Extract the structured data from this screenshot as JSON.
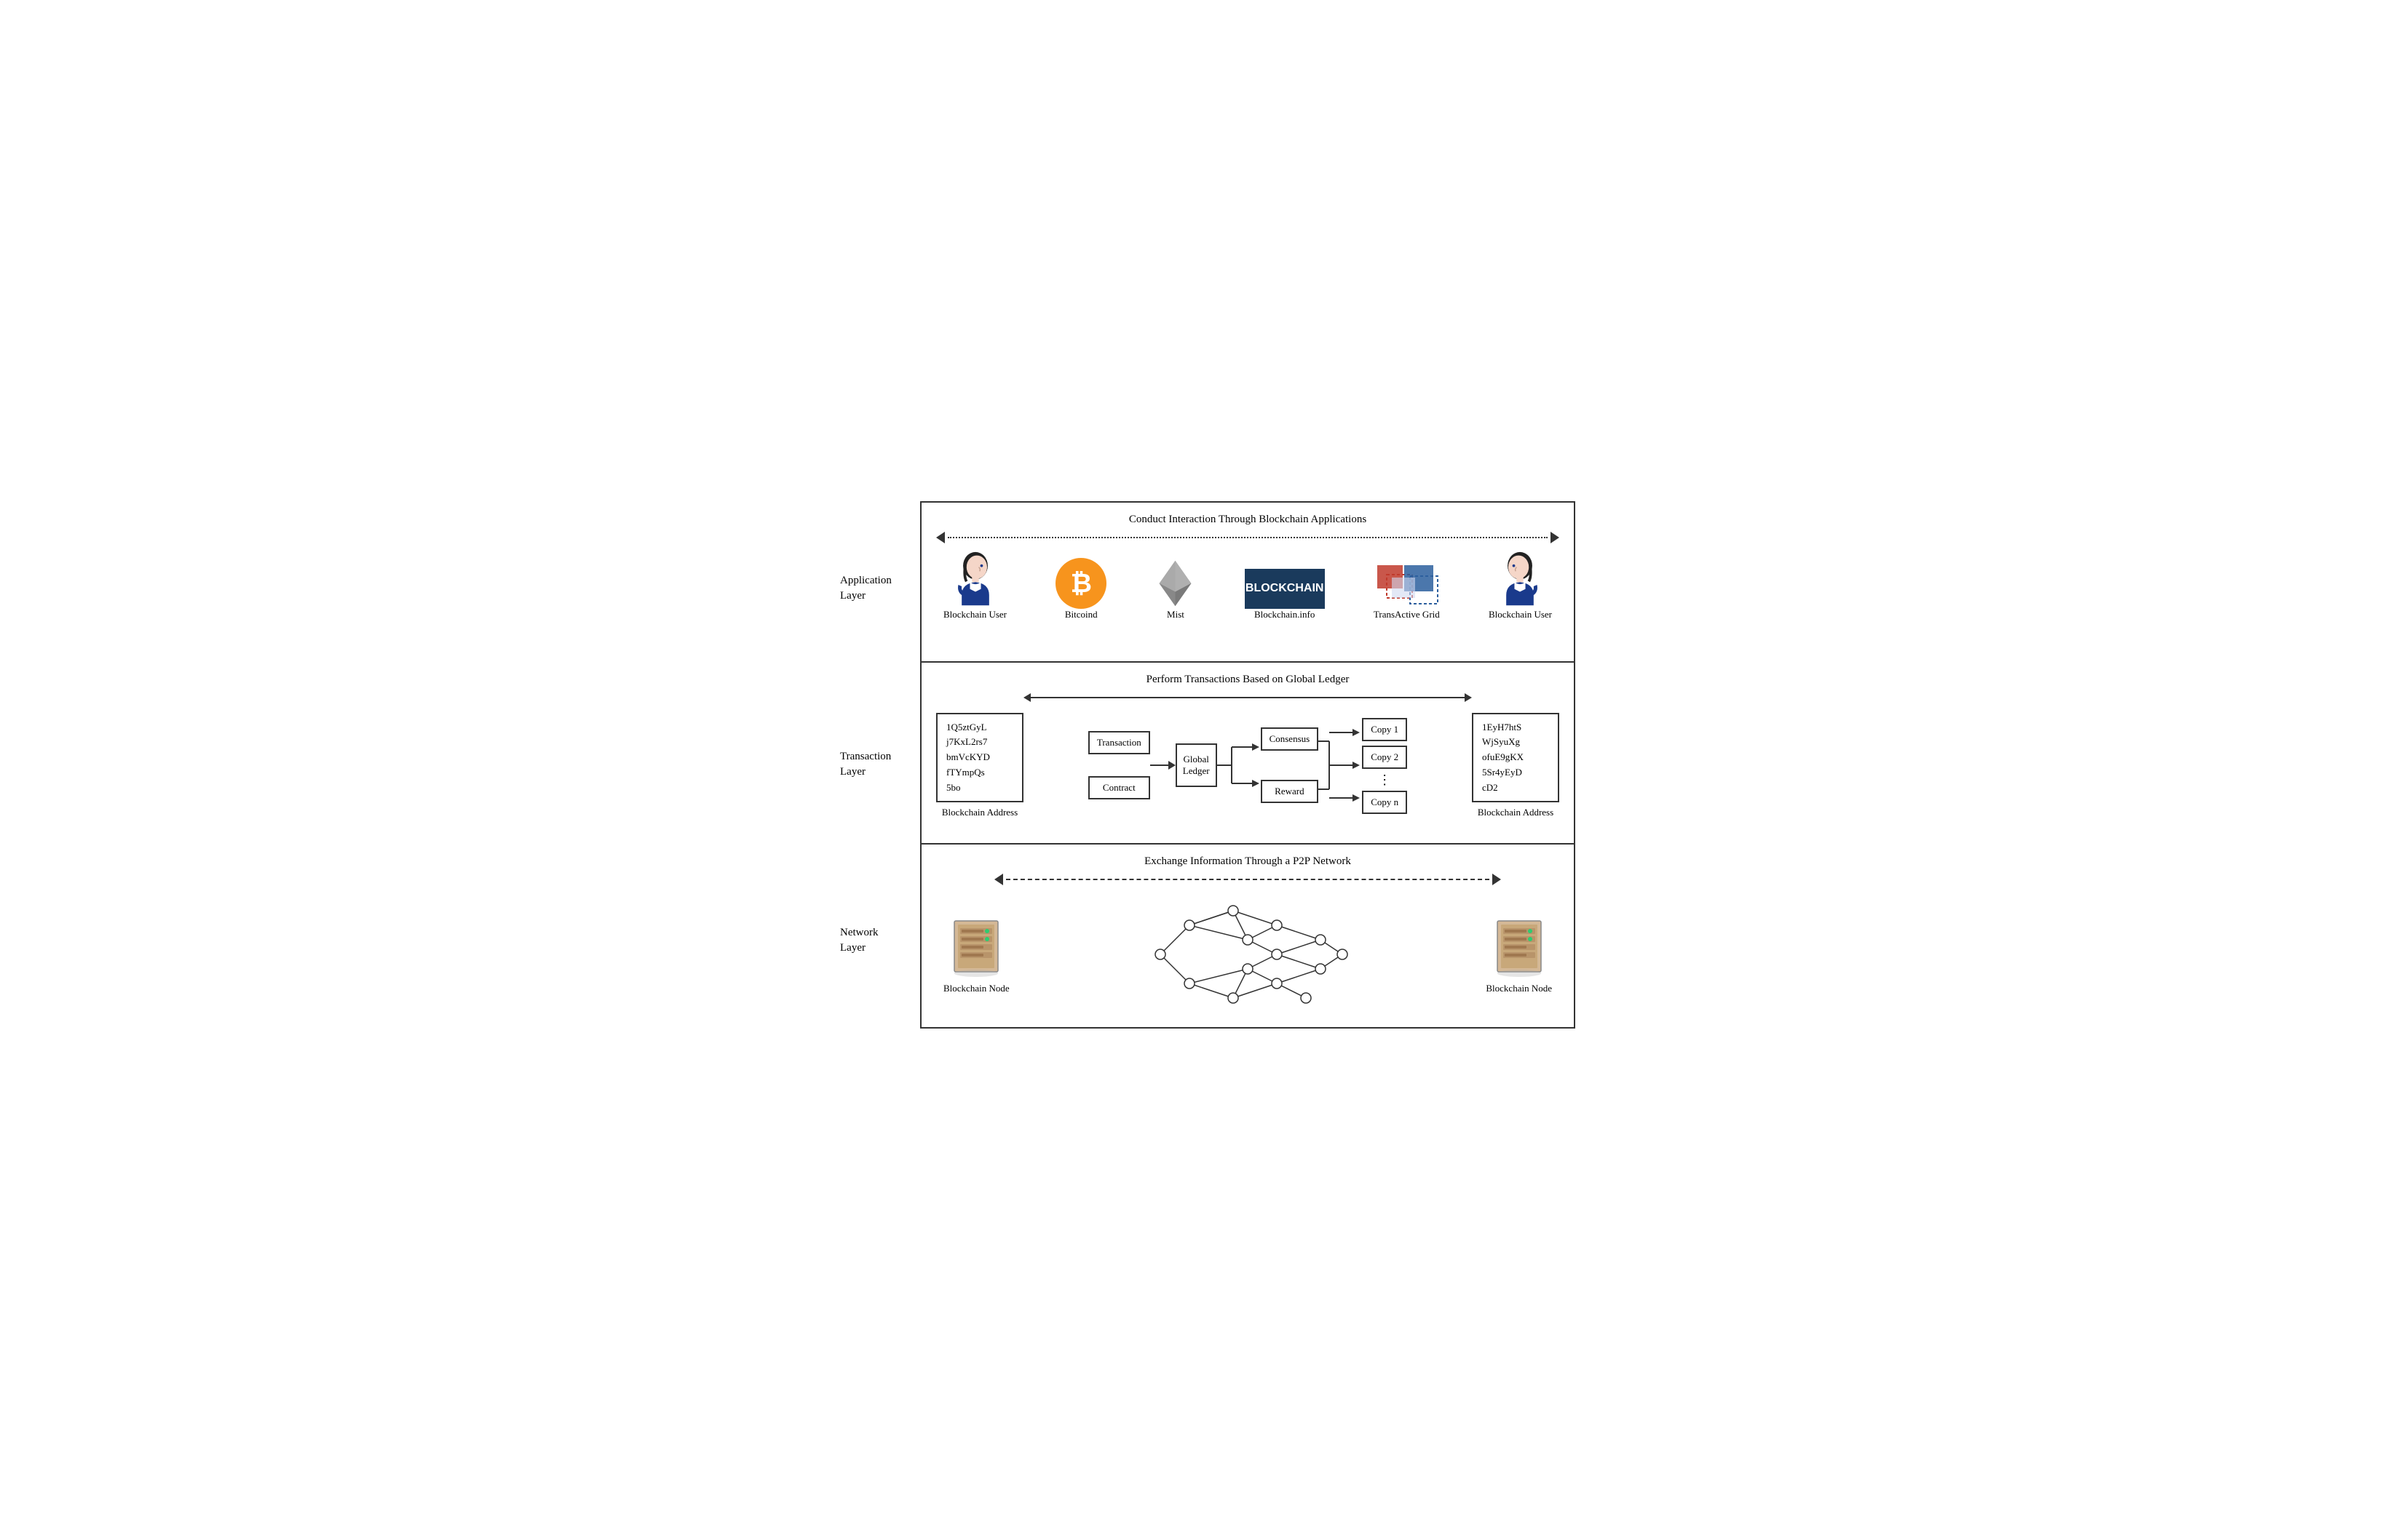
{
  "app_layer": {
    "label": "Application\nLayer",
    "top_text": "Conduct Interaction Through Blockchain Applications",
    "user_left_label": "Blockchain User",
    "user_right_label": "Blockchain User",
    "icons": [
      {
        "name": "bitcoin_label",
        "value": "Bitcoind"
      },
      {
        "name": "mist_label",
        "value": "Mist"
      },
      {
        "name": "blockchain_info_label",
        "value": "Blockchain.info"
      },
      {
        "name": "transactive_label",
        "value": "TransActive Grid"
      }
    ]
  },
  "tx_layer": {
    "label": "Transaction\nLayer",
    "top_text": "Perform Transactions Based on Global Ledger",
    "addr_left": {
      "lines": [
        "1Q5ztGyL",
        "j7KxL2rs7",
        "bmVcKYD",
        "fTYmpQs",
        "5bo"
      ],
      "label": "Blockchain Address"
    },
    "addr_right": {
      "lines": [
        "1EyH7htS",
        "WjSyuXg",
        "ofuE9gKX",
        "5Sr4yEyD",
        "cD2"
      ],
      "label": "Blockchain Address"
    },
    "box_transaction": "Transaction",
    "box_contract": "Contract",
    "box_global_ledger": "Global\nLedger",
    "box_consensus": "Consensus",
    "box_reward": "Reward",
    "copy1": "Copy 1",
    "copy2": "Copy 2",
    "copy_n": "Copy n",
    "ellipsis": "⋮"
  },
  "net_layer": {
    "label": "Network\nLayer",
    "top_text": "Exchange Information Through a P2P Network",
    "node_left_label": "Blockchain Node",
    "node_right_label": "Blockchain Node"
  }
}
